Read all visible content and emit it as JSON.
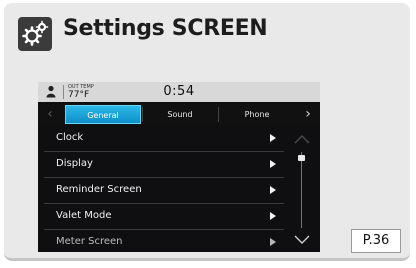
{
  "header": {
    "title": "Settings SCREEN",
    "icon": "gear-icon"
  },
  "screen": {
    "status": {
      "temp_label": "OUT TEMP",
      "temp_value": "77°F",
      "time": "0:54",
      "user_icon": "user-icon"
    },
    "tabs": [
      {
        "label": "General",
        "active": true
      },
      {
        "label": "Sound",
        "active": false
      },
      {
        "label": "Phone",
        "active": false
      }
    ],
    "menu": [
      {
        "label": "Clock"
      },
      {
        "label": "Display"
      },
      {
        "label": "Reminder Screen"
      },
      {
        "label": "Valet Mode"
      },
      {
        "label": "Meter Screen"
      }
    ],
    "colors": {
      "active_tab": "#1ea6dc",
      "screen_bg": "#0f0f12"
    }
  },
  "page_ref": "P.36"
}
